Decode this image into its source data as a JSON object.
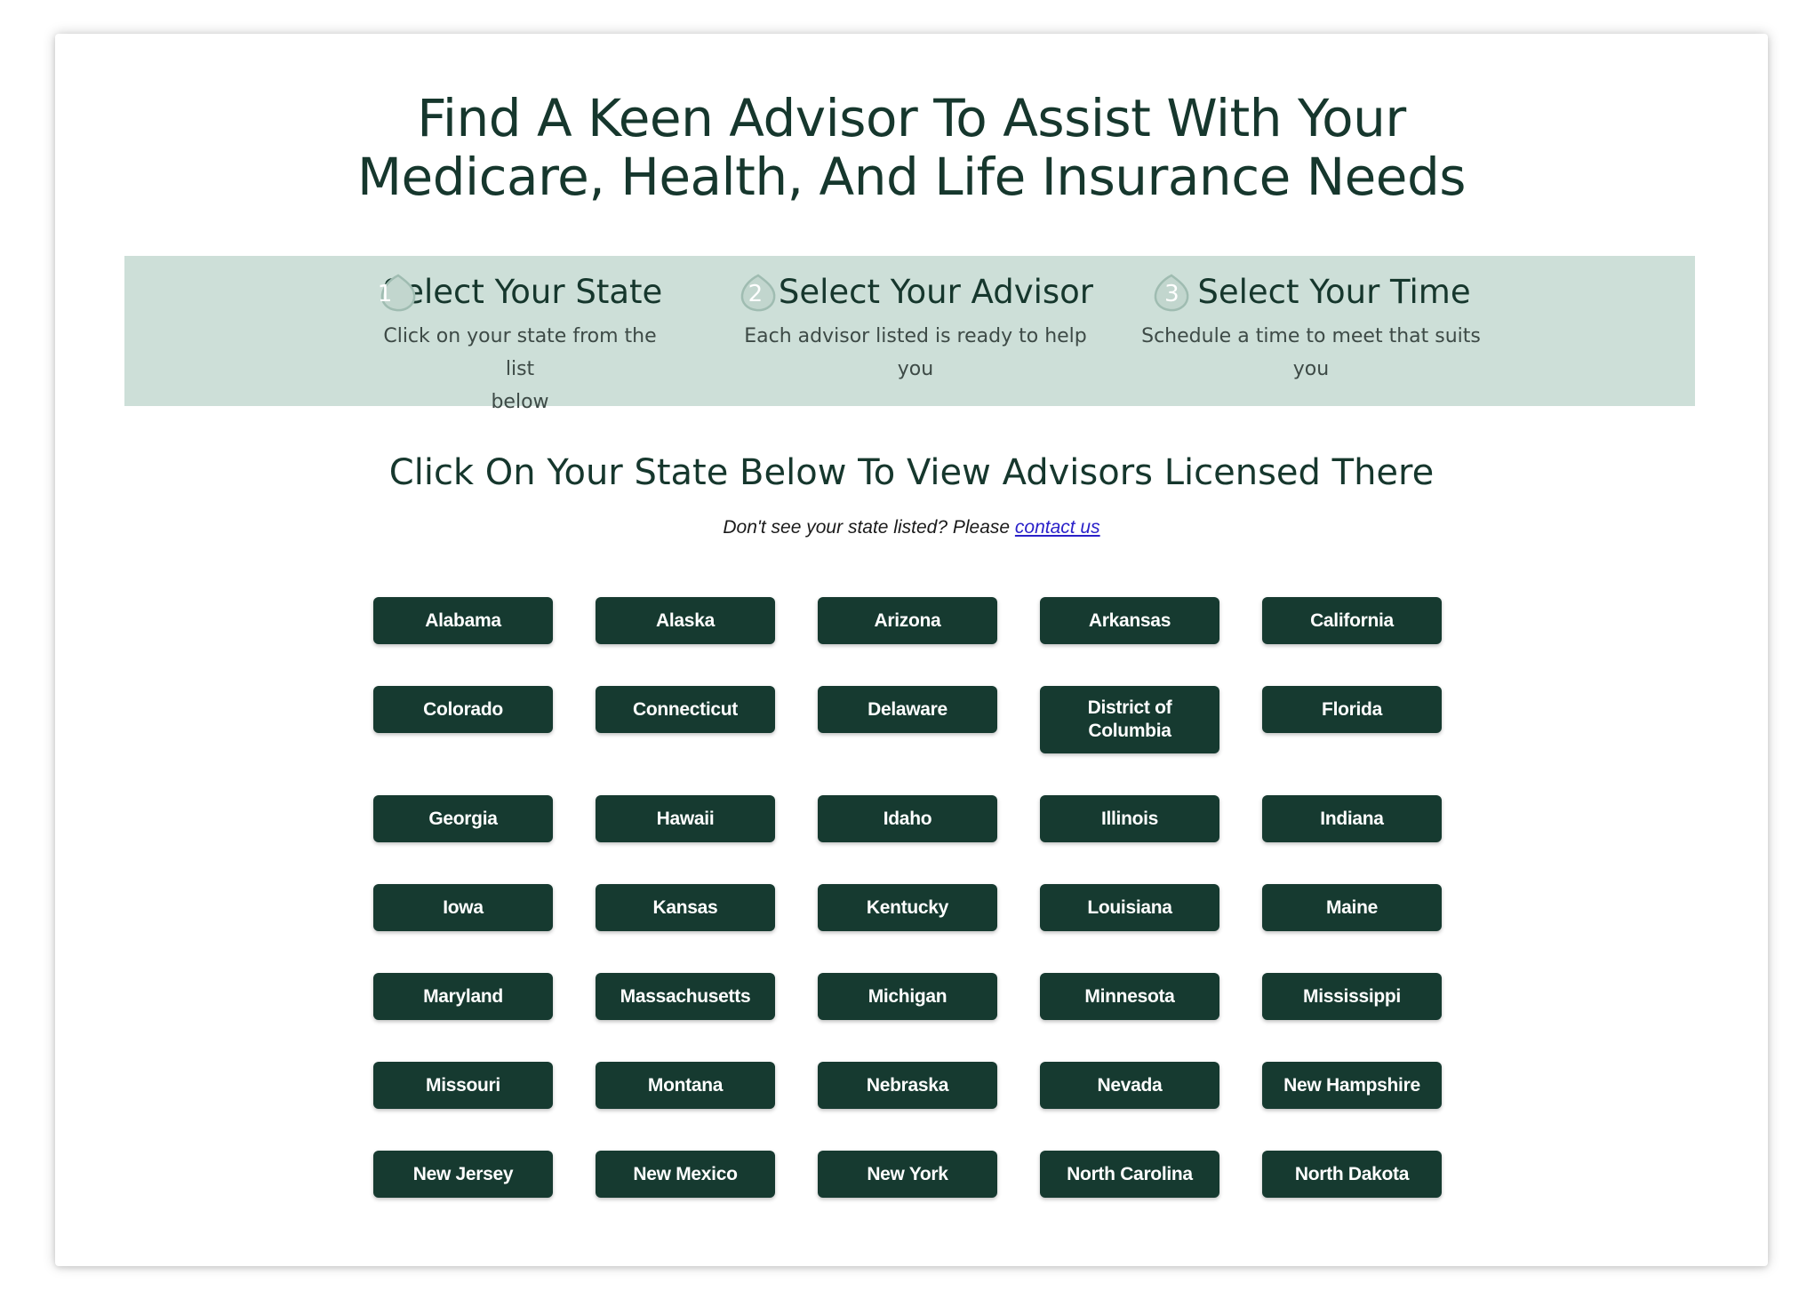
{
  "header": {
    "title_line1": "Find A Keen Advisor To Assist With Your",
    "title_line2": "Medicare, Health, And Life Insurance Needs"
  },
  "steps": [
    {
      "number": "1",
      "title": "Select Your State",
      "desc_line1": "Click on your state from the list",
      "desc_line2": "below",
      "icon": "step-number-badge-icon"
    },
    {
      "number": "2",
      "title": "Select Your Advisor",
      "desc_line1": "Each advisor listed is ready to help",
      "desc_line2": "you",
      "icon": "step-number-badge-icon"
    },
    {
      "number": "3",
      "title": "Select Your Time",
      "desc_line1": "Schedule a time to meet that suits",
      "desc_line2": "you",
      "icon": "step-number-badge-icon"
    }
  ],
  "states_section": {
    "title": "Click On Your State Below To View Advisors Licensed There",
    "note_prefix": "Don't see your state listed? Please ",
    "note_link": "contact us"
  },
  "states": [
    "Alabama",
    "Alaska",
    "Arizona",
    "Arkansas",
    "California",
    "Colorado",
    "Connecticut",
    "Delaware",
    "District of Columbia",
    "Florida",
    "Georgia",
    "Hawaii",
    "Idaho",
    "Illinois",
    "Indiana",
    "Iowa",
    "Kansas",
    "Kentucky",
    "Louisiana",
    "Maine",
    "Maryland",
    "Massachusetts",
    "Michigan",
    "Minnesota",
    "Mississippi",
    "Missouri",
    "Montana",
    "Nebraska",
    "Nevada",
    "New Hampshire",
    "New Jersey",
    "New Mexico",
    "New York",
    "North Carolina",
    "North Dakota"
  ],
  "colors": {
    "heading": "#16372d",
    "band": "#cddfd8",
    "button": "#163a30",
    "button_text": "#ffffff",
    "link": "#2a21c9"
  }
}
